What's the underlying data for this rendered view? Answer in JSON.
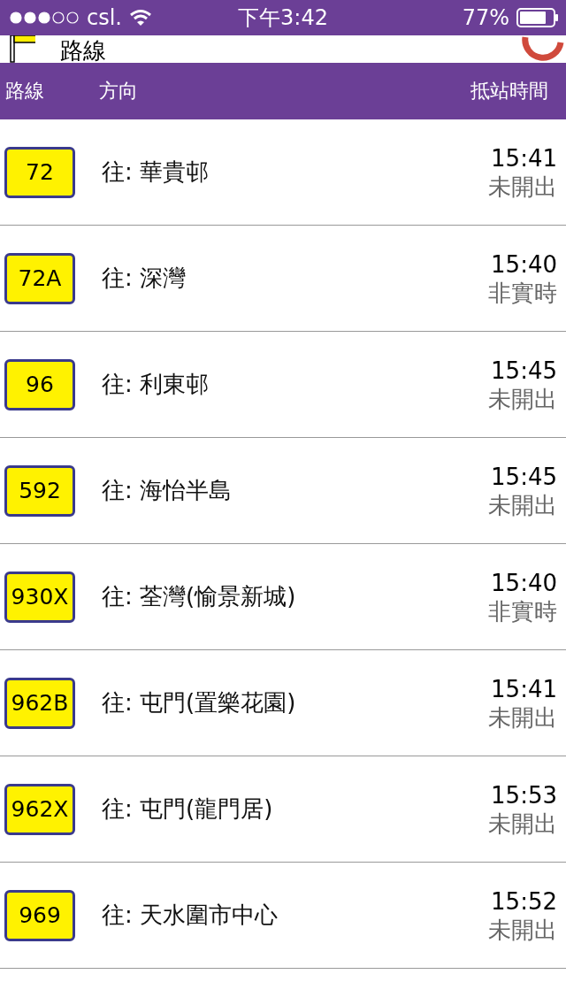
{
  "status_bar": {
    "carrier": "csl.",
    "time": "下午3:42",
    "battery": "77%"
  },
  "header": {
    "title": "路線"
  },
  "table": {
    "columns": [
      "路線",
      "方向",
      "抵站時間"
    ],
    "rows": [
      {
        "route": "72",
        "direction": "往: 華貴邨",
        "time": "15:41",
        "status": "未開出"
      },
      {
        "route": "72A",
        "direction": "往: 深灣",
        "time": "15:40",
        "status": "非實時"
      },
      {
        "route": "96",
        "direction": "往: 利東邨",
        "time": "15:45",
        "status": "未開出"
      },
      {
        "route": "592",
        "direction": "往: 海怡半島",
        "time": "15:45",
        "status": "未開出"
      },
      {
        "route": "930X",
        "direction": "往: 荃灣(愉景新城)",
        "time": "15:40",
        "status": "非實時"
      },
      {
        "route": "962B",
        "direction": "往: 屯門(置樂花園)",
        "time": "15:41",
        "status": "未開出"
      },
      {
        "route": "962X",
        "direction": "往: 屯門(龍門居)",
        "time": "15:53",
        "status": "未開出"
      },
      {
        "route": "969",
        "direction": "往: 天水圍市中心",
        "time": "15:52",
        "status": "未開出"
      }
    ]
  }
}
